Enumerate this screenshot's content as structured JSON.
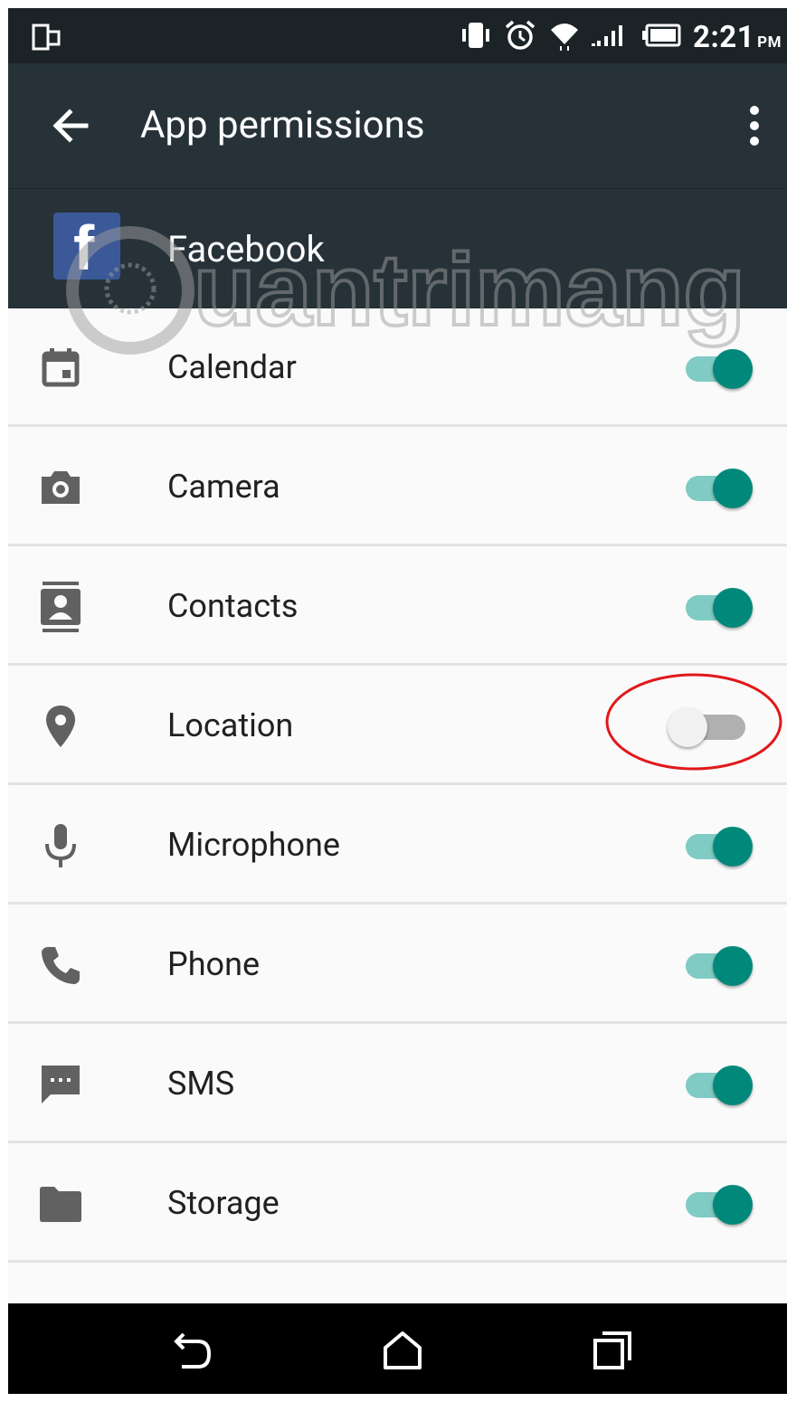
{
  "status_bar": {
    "time": "2:21",
    "ampm": "PM"
  },
  "toolbar": {
    "title": "App permissions"
  },
  "app": {
    "name": "Facebook",
    "logo_letter": "f"
  },
  "permissions": [
    {
      "label": "Calendar",
      "icon": "calendar-icon",
      "enabled": true
    },
    {
      "label": "Camera",
      "icon": "camera-icon",
      "enabled": true
    },
    {
      "label": "Contacts",
      "icon": "contacts-icon",
      "enabled": true
    },
    {
      "label": "Location",
      "icon": "location-icon",
      "enabled": false
    },
    {
      "label": "Microphone",
      "icon": "microphone-icon",
      "enabled": true
    },
    {
      "label": "Phone",
      "icon": "phone-icon",
      "enabled": true
    },
    {
      "label": "SMS",
      "icon": "sms-icon",
      "enabled": true
    },
    {
      "label": "Storage",
      "icon": "storage-icon",
      "enabled": true
    }
  ],
  "watermark": "uantrimang",
  "colors": {
    "statusbar": "#1b2327",
    "toolbar": "#263238",
    "accent": "#00897b",
    "accent_track": "#80cbc4",
    "highlight": "#e0181b",
    "facebook": "#3b5998"
  }
}
